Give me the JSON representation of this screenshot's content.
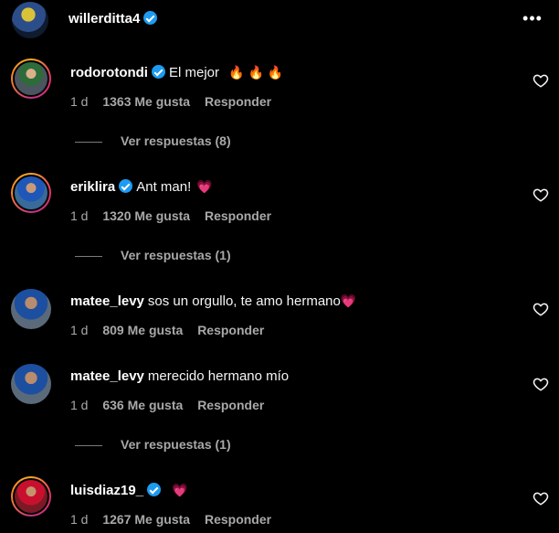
{
  "post": {
    "username": "willerditta4",
    "verified": true
  },
  "comments": [
    {
      "username": "rodorotondi",
      "verified": true,
      "text": "El mejor",
      "emoji": "🔥 🔥 🔥",
      "time": "1 d",
      "likes": "1363 Me gusta",
      "reply": "Responder",
      "replies": "Ver respuestas (8)"
    },
    {
      "username": "eriklira",
      "verified": true,
      "text": "Ant man!",
      "emoji": "💗",
      "time": "1 d",
      "likes": "1320 Me gusta",
      "reply": "Responder",
      "replies": "Ver respuestas (1)"
    },
    {
      "username": "matee_levy",
      "verified": false,
      "text": "sos un orgullo, te amo hermano",
      "emoji": "💗",
      "time": "1 d",
      "likes": "809 Me gusta",
      "reply": "Responder"
    },
    {
      "username": "matee_levy",
      "verified": false,
      "text": "merecido hermano mío",
      "emoji": "",
      "time": "1 d",
      "likes": "636 Me gusta",
      "reply": "Responder",
      "replies": "Ver respuestas (1)"
    },
    {
      "username": "luisdiaz19_",
      "verified": true,
      "text": "",
      "emoji": "💗",
      "time": "1 d",
      "likes": "1267 Me gusta",
      "reply": "Responder"
    }
  ],
  "icons": {
    "more": "more-options-icon",
    "like": "heart-outline-icon",
    "verified": "verified-badge-icon"
  },
  "colors": {
    "background": "#000000",
    "verified": "#1d9bf0",
    "muted": "#a8a8a8"
  }
}
